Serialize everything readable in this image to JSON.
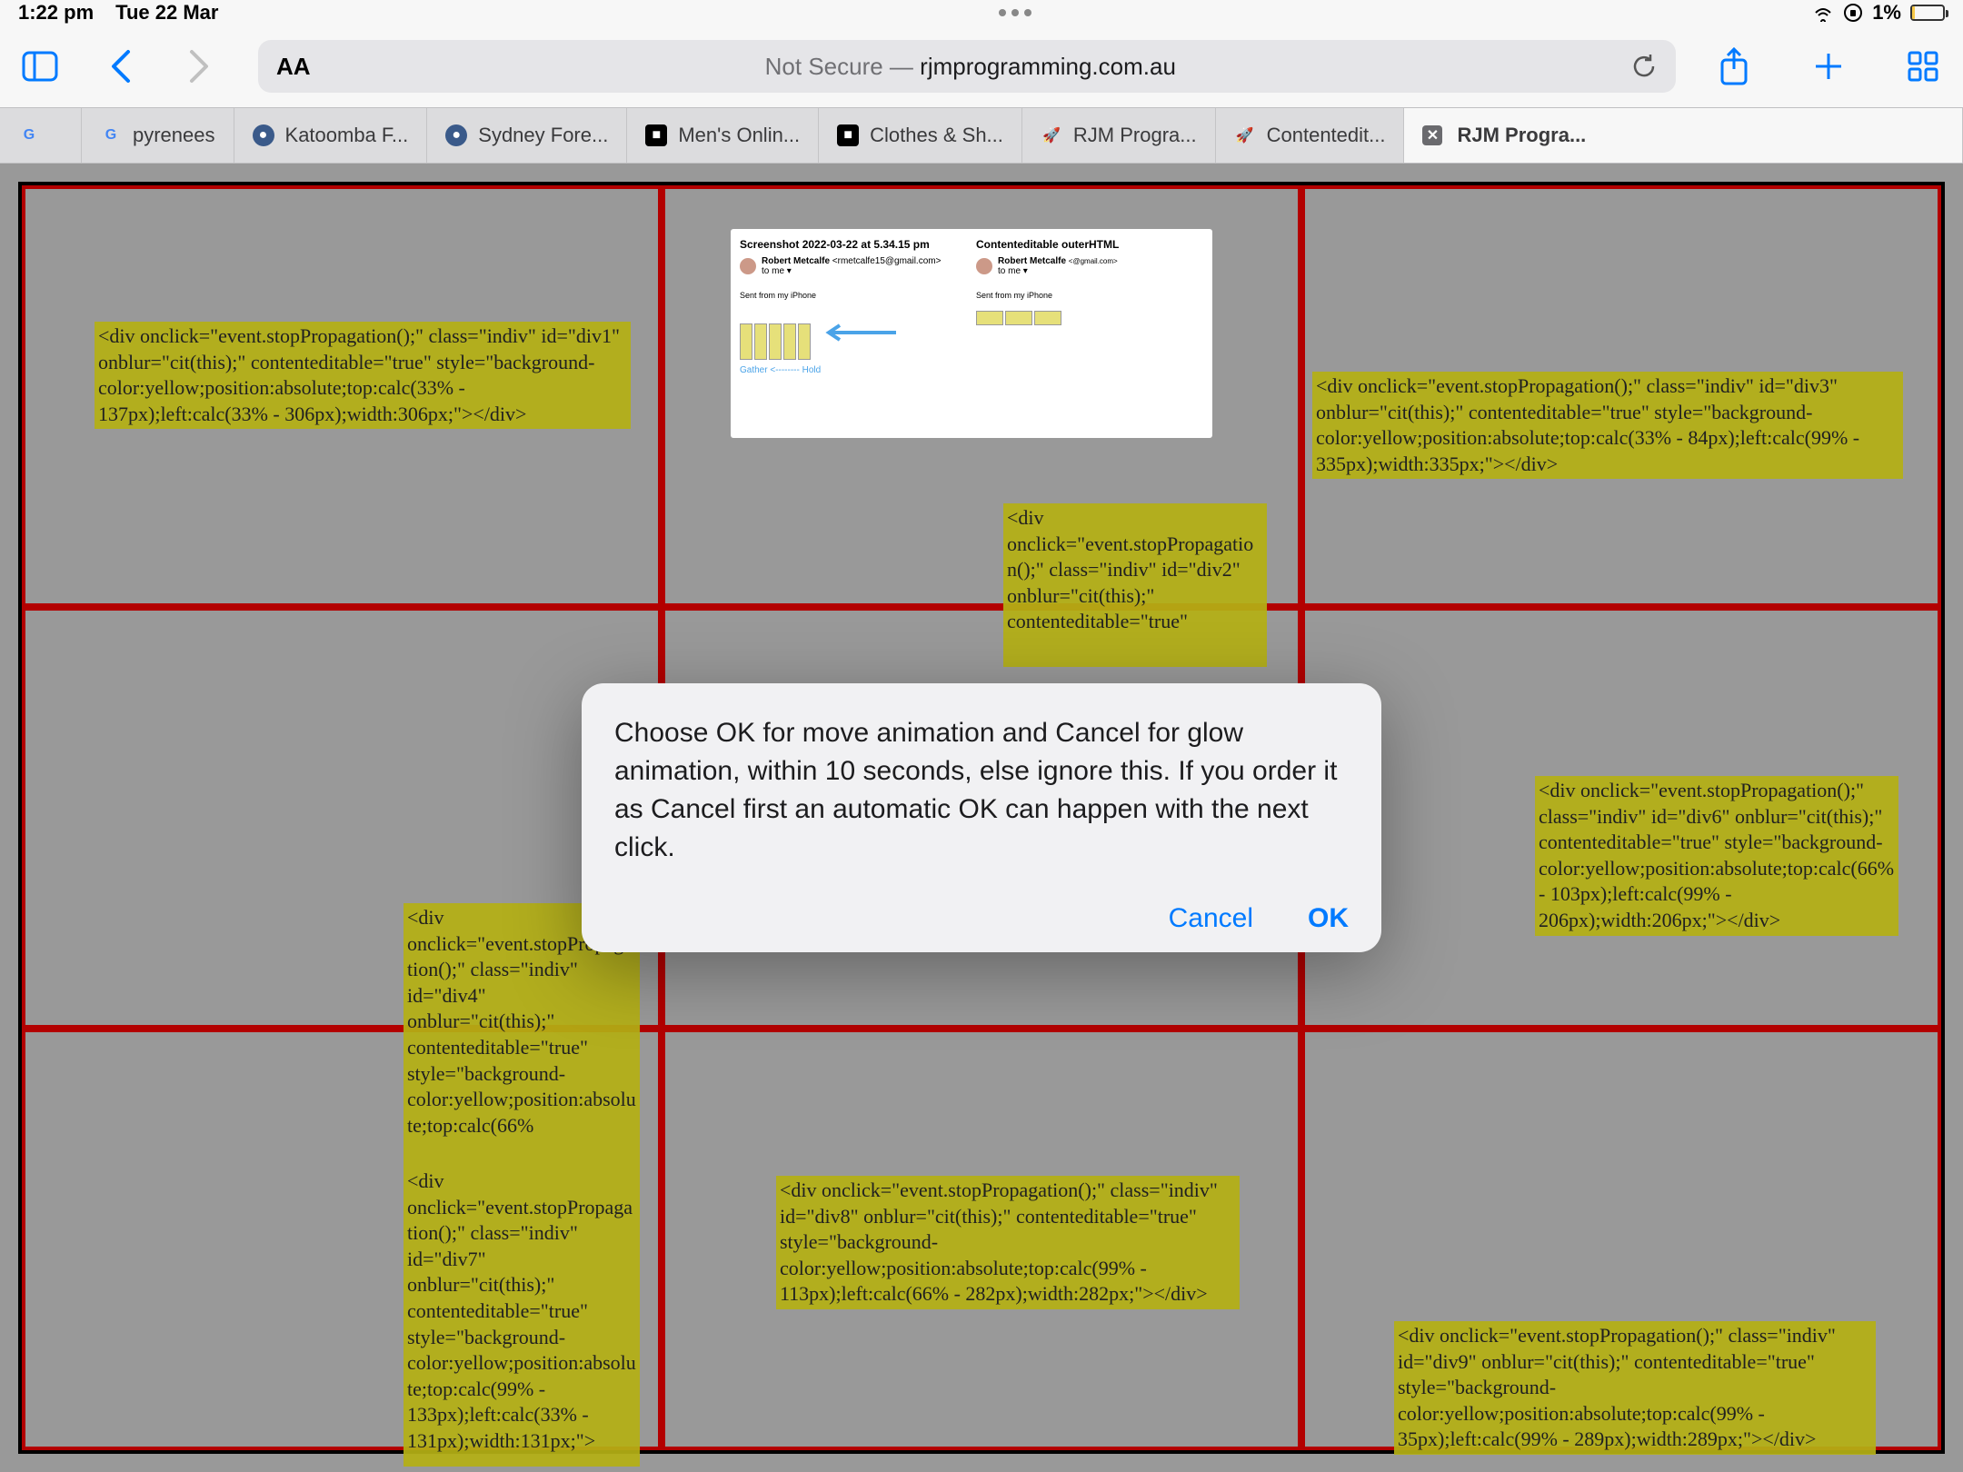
{
  "status": {
    "time": "1:22 pm",
    "date": "Tue 22 Mar",
    "battery_pct": "1%"
  },
  "toolbar": {
    "url_prefix": "Not Secure —",
    "url_host": "rjmprogramming.com.au",
    "aa_label": "AA"
  },
  "tabs": [
    {
      "label": "",
      "favicon": "G"
    },
    {
      "label": "pyrenees",
      "favicon": "G"
    },
    {
      "label": "Katoomba F...",
      "favicon": "●"
    },
    {
      "label": "Sydney Fore...",
      "favicon": "●"
    },
    {
      "label": "Men's Onlin...",
      "favicon": "■"
    },
    {
      "label": "Clothes & Sh...",
      "favicon": "■"
    },
    {
      "label": "RJM Progra...",
      "favicon": "🚀"
    },
    {
      "label": "Contentedit...",
      "favicon": "🚀"
    },
    {
      "label": "RJM Progra...",
      "favicon": "✕",
      "active": true
    }
  ],
  "divs": {
    "div1": "<div onclick=\"event.stopPropagation();\" class=\"indiv\" id=\"div1\" onblur=\"cit(this);\" contenteditable=\"true\" style=\"background-color:yellow;position:absolute;top:calc(33% - 137px);left:calc(33% - 306px);width:306px;\"></div>",
    "div2": "<div onclick=\"event.stopPropagation();\" class=\"indiv\" id=\"div2\" onblur=\"cit(this);\" contenteditable=\"true\"",
    "div3": "<div onclick=\"event.stopPropagation();\" class=\"indiv\" id=\"div3\" onblur=\"cit(this);\" contenteditable=\"true\" style=\"background-color:yellow;position:absolute;top:calc(33% - 84px);left:calc(99% - 335px);width:335px;\"></div>",
    "div4": "<div onclick=\"event.stopPropagation();\" class=\"indiv\" id=\"div4\" onblur=\"cit(this);\" contenteditable=\"true\" style=\"background-color:yellow;position:absolute;top:calc(66%",
    "div6": "<div onclick=\"event.stopPropagation();\" class=\"indiv\" id=\"div6\" onblur=\"cit(this);\" contenteditable=\"true\" style=\"background-color:yellow;position:absolute;top:calc(66% - 103px);left:calc(99% - 206px);width:206px;\"></div>",
    "div7": "<div onclick=\"event.stopPropagation();\" class=\"indiv\" id=\"div7\" onblur=\"cit(this);\" contenteditable=\"true\" style=\"background-color:yellow;position:absolute;top:calc(99% - 133px);left:calc(33% - 131px);width:131px;\">",
    "div8": "<div onclick=\"event.stopPropagation();\" class=\"indiv\" id=\"div8\" onblur=\"cit(this);\" contenteditable=\"true\" style=\"background-color:yellow;position:absolute;top:calc(99% - 113px);left:calc(66% - 282px);width:282px;\"></div>",
    "div9": "<div onclick=\"event.stopPropagation();\" class=\"indiv\" id=\"div9\" onblur=\"cit(this);\" contenteditable=\"true\" style=\"background-color:yellow;position:absolute;top:calc(99% - 35px);left:calc(99% - 289px);width:289px;\"></div>"
  },
  "email": {
    "left_title": "Screenshot 2022-03-22 at 5.34.15 pm",
    "right_title": "Contenteditable outerHTML",
    "sender": "Robert Metcalfe",
    "sender_email": "<rmetcalfe15@gmail.com>",
    "to": "to me",
    "sent_from": "Sent from my iPhone",
    "arrow_text": "Gather <-------- Hold"
  },
  "dialog": {
    "message": "Choose OK for move animation and Cancel for glow animation, within 10 seconds, else ignore this.  If you order it as Cancel first an automatic OK can happen with the next click.",
    "cancel": "Cancel",
    "ok": "OK"
  }
}
